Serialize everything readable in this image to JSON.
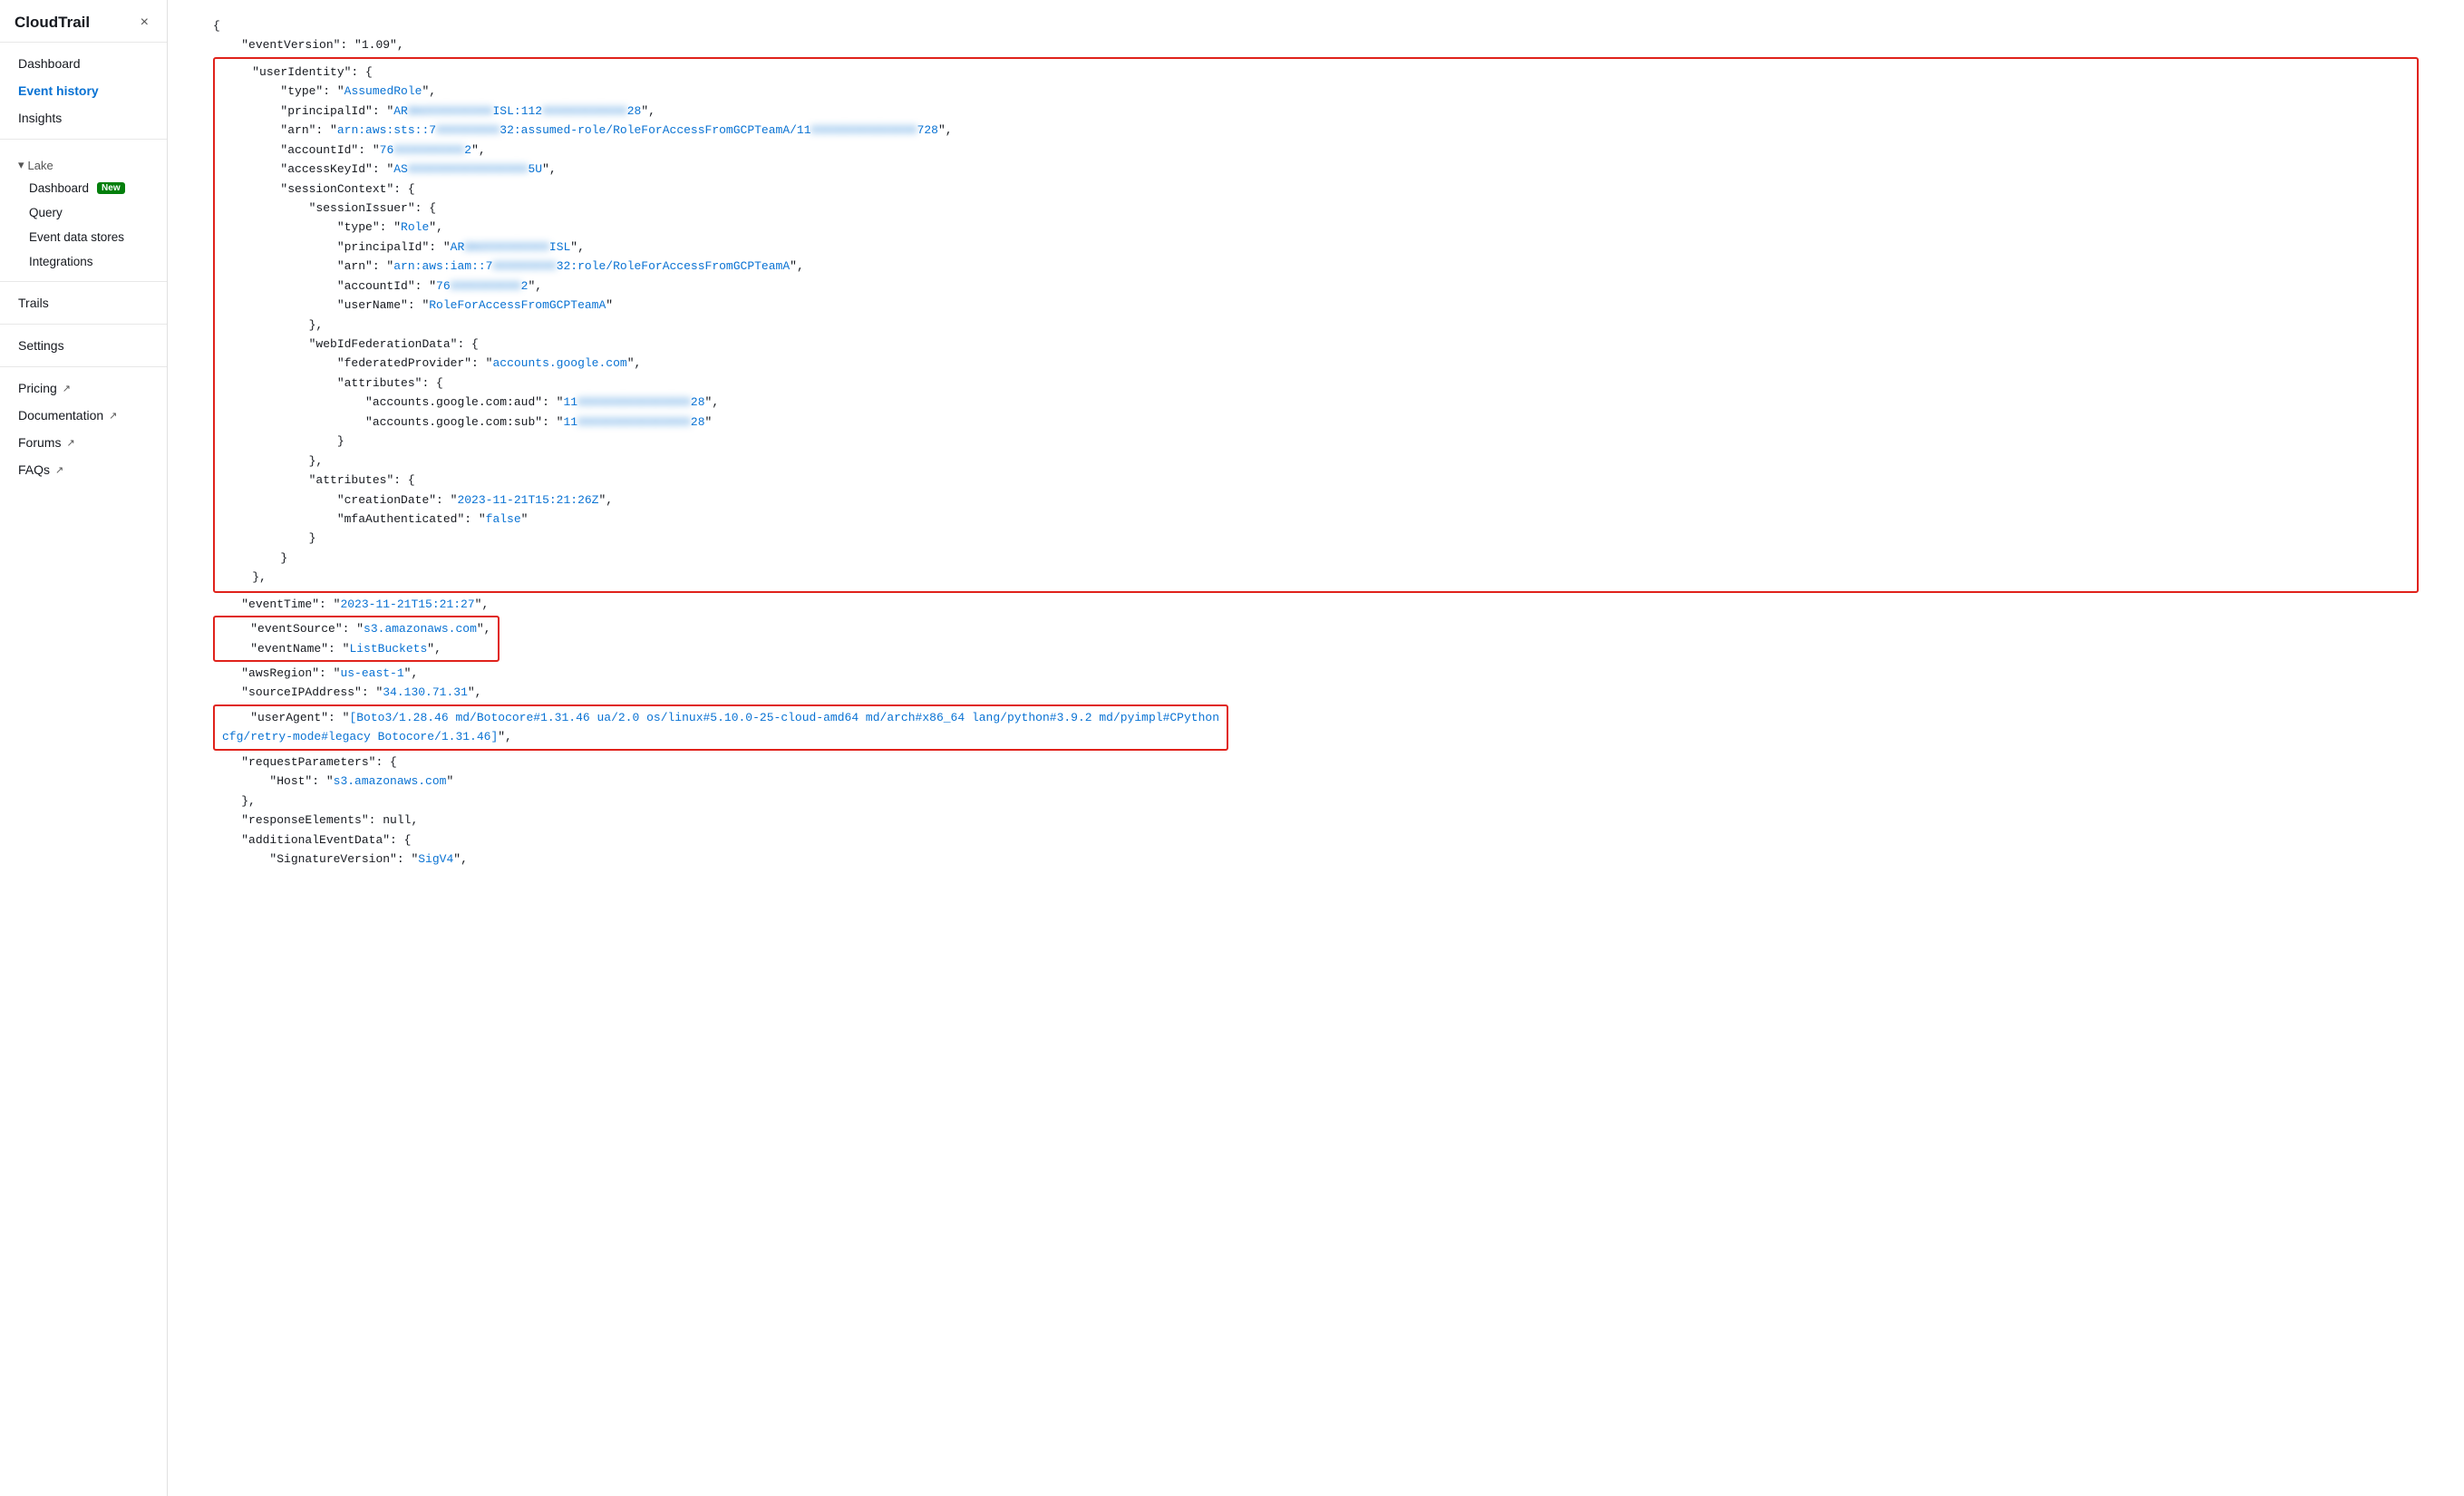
{
  "sidebar": {
    "title": "CloudTrail",
    "close_label": "×",
    "nav_items": [
      {
        "id": "dashboard",
        "label": "Dashboard",
        "active": false,
        "level": "top"
      },
      {
        "id": "event-history",
        "label": "Event history",
        "active": true,
        "level": "top"
      },
      {
        "id": "insights",
        "label": "Insights",
        "active": false,
        "level": "top"
      },
      {
        "id": "lake",
        "label": "Lake",
        "active": false,
        "level": "section"
      },
      {
        "id": "dashboard-new",
        "label": "Dashboard",
        "badge": "New",
        "active": false,
        "level": "sub"
      },
      {
        "id": "query",
        "label": "Query",
        "active": false,
        "level": "sub"
      },
      {
        "id": "event-data-stores",
        "label": "Event data stores",
        "active": false,
        "level": "sub"
      },
      {
        "id": "integrations",
        "label": "Integrations",
        "active": false,
        "level": "sub"
      },
      {
        "id": "trails",
        "label": "Trails",
        "active": false,
        "level": "top"
      },
      {
        "id": "settings",
        "label": "Settings",
        "active": false,
        "level": "top"
      },
      {
        "id": "pricing",
        "label": "Pricing",
        "external": true,
        "active": false,
        "level": "top"
      },
      {
        "id": "documentation",
        "label": "Documentation",
        "external": true,
        "active": false,
        "level": "top"
      },
      {
        "id": "forums",
        "label": "Forums",
        "external": true,
        "active": false,
        "level": "top"
      },
      {
        "id": "faqs",
        "label": "FAQs",
        "external": true,
        "active": false,
        "level": "top"
      }
    ]
  },
  "json_content": {
    "eventVersion": "1.09",
    "userIdentity_type": "AssumedRole",
    "principalId_partial": "AR",
    "principalId_mid": "ISL:112",
    "principalId_end": "28",
    "arn_prefix": "arn:aws:sts::7",
    "arn_mid": "32:assumed-role/RoleForAccessFromGCPTeamA/11",
    "arn_end": "728",
    "accountId_partial": "76",
    "accountId_end": "2",
    "accessKeyId_partial": "AS",
    "accessKeyId_end": "5U",
    "sessionIssuer_type": "Role",
    "sessionIssuer_principalId": "AR",
    "sessionIssuer_principalId_end": "ISL",
    "sessionIssuer_arn": "arn:aws:iam::7",
    "sessionIssuer_arn_mid": "32:role/RoleForAccessFromGCPTeamA",
    "sessionIssuer_accountId": "76",
    "sessionIssuer_accountId_end": "2",
    "sessionIssuer_userName": "RoleForAccessFromGCPTeamA",
    "federatedProvider": "accounts.google.com",
    "aud_partial": "11",
    "aud_end": "28",
    "sub_partial": "11",
    "sub_end": "28",
    "creationDate": "2023-11-21T15:21:26Z",
    "mfaAuthenticated": "false",
    "eventTime": "2023-11-21T15:21:27",
    "eventSource": "s3.amazonaws.com",
    "eventName": "ListBuckets",
    "awsRegion": "us-east-1",
    "sourceIPAddress": "34.130.71.31",
    "userAgent": "[Boto3/1.28.46 md/Botocore#1.31.46 ua/2.0 os/linux#5.10.0-25-cloud-amd64 md/arch#x86_64 lang/python#3.9.2 md/pyimpl#CPython cfg/retry-mode#legacy Botocore/1.31.46]",
    "requestParameters_host": "s3.amazonaws.com",
    "responseElements": "null",
    "signatureVersion": "SigV4"
  }
}
